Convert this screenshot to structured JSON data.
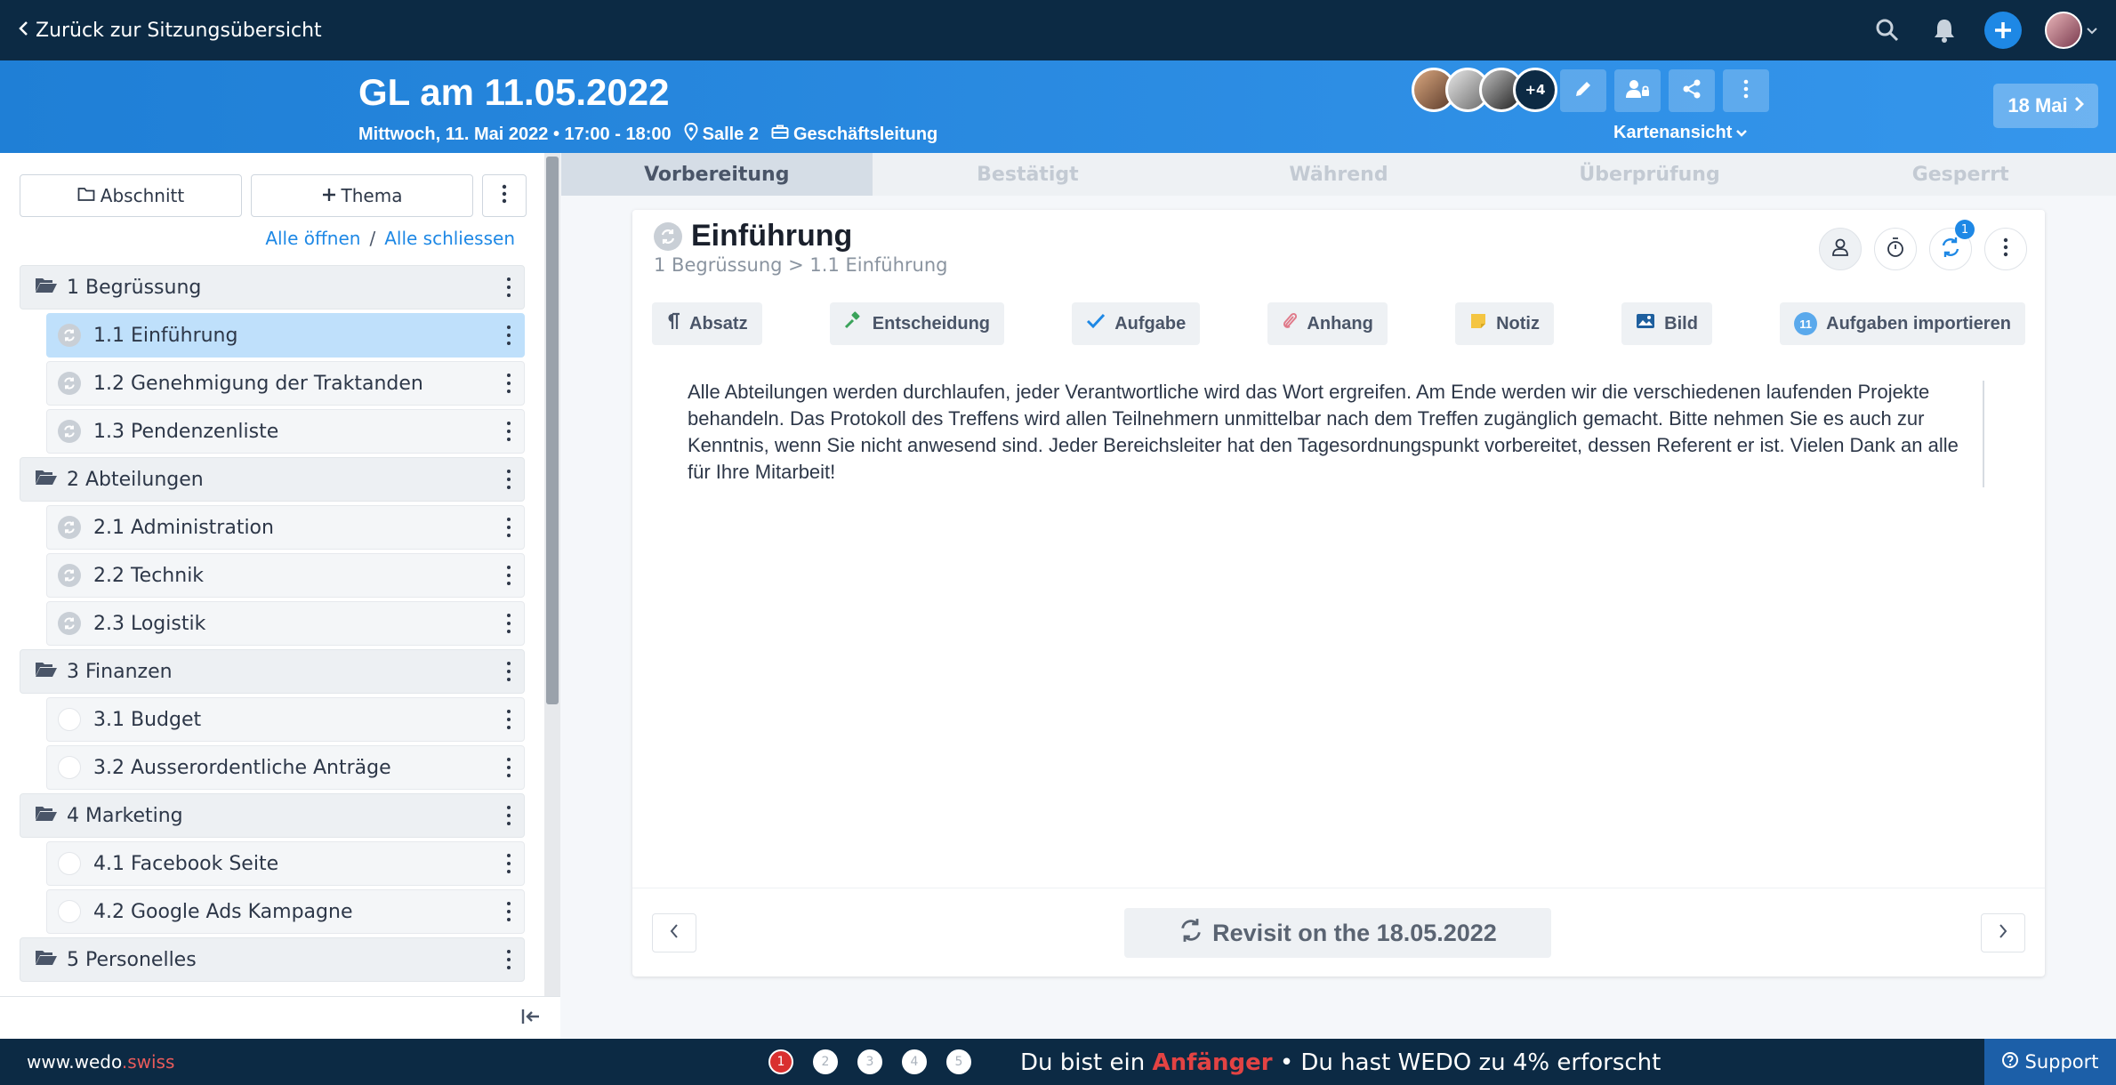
{
  "topbar": {
    "back_label": "Zurück zur Sitzungsübersicht",
    "icons": [
      "search-icon",
      "bell-icon",
      "plus-icon",
      "user-avatar"
    ]
  },
  "header": {
    "title": "GL am 11.05.2022",
    "date_time": "Mittwoch, 11. Mai 2022 • 17:00 - 18:00",
    "location": "Salle 2",
    "group": "Geschäftsleitung",
    "participants_more": "+4",
    "view_mode": "Kartenansicht",
    "next_date": "18 Mai"
  },
  "sidebar": {
    "section_button": "Abschnitt",
    "topic_button": "Thema",
    "open_all": "Alle öffnen",
    "separator": "/",
    "close_all": "Alle schliessen",
    "sections": [
      {
        "label": "1 Begrüssung",
        "items": [
          {
            "label": "1.1 Einführung",
            "status": "done",
            "active": true
          },
          {
            "label": "1.2 Genehmigung der Traktanden",
            "status": "done",
            "active": false
          },
          {
            "label": "1.3 Pendenzenliste",
            "status": "done",
            "active": false
          }
        ]
      },
      {
        "label": "2 Abteilungen",
        "items": [
          {
            "label": "2.1 Administration",
            "status": "done",
            "active": false
          },
          {
            "label": "2.2 Technik",
            "status": "done",
            "active": false
          },
          {
            "label": "2.3 Logistik",
            "status": "done",
            "active": false
          }
        ]
      },
      {
        "label": "3 Finanzen",
        "items": [
          {
            "label": "3.1 Budget",
            "status": "empty",
            "active": false
          },
          {
            "label": "3.2 Ausserordentliche Anträge",
            "status": "empty",
            "active": false
          }
        ]
      },
      {
        "label": "4 Marketing",
        "items": [
          {
            "label": "4.1 Facebook Seite",
            "status": "empty",
            "active": false
          },
          {
            "label": "4.2 Google Ads Kampagne",
            "status": "empty",
            "active": false
          }
        ]
      },
      {
        "label": "5 Personelles",
        "items": []
      }
    ]
  },
  "stepper": [
    "Vorbereitung",
    "Bestätigt",
    "Während",
    "Überprüfung",
    "Gesperrt"
  ],
  "card": {
    "title": "Einführung",
    "breadcrumb": "1 Begrüssung > 1.1 Einführung",
    "sync_badge": "1",
    "add_buttons": {
      "paragraph": "Absatz",
      "decision": "Entscheidung",
      "task": "Aufgabe",
      "attachment": "Anhang",
      "note": "Notiz",
      "image": "Bild",
      "import_count": "11",
      "import": "Aufgaben importieren"
    },
    "content": "Alle Abteilungen werden durchlaufen, jeder Verantwortliche wird das Wort ergreifen. Am Ende werden wir die verschiedenen laufenden Projekte behandeln. Das Protokoll des Treffens wird allen Teilnehmern unmittelbar nach dem Treffen zugänglich gemacht. Bitte nehmen Sie es auch zur Kenntnis, wenn Sie nicht anwesend sind. Jeder Bereichsleiter hat den Tagesordnungspunkt vorbereitet, dessen Referent er ist. Vielen Dank an alle für Ihre Mitarbeit!",
    "revisit": "Revisit on the 18.05.2022"
  },
  "bottombar": {
    "site_prefix": "www.wedo",
    "site_suffix": ".swiss",
    "dots": [
      "1",
      "2",
      "3",
      "4",
      "5"
    ],
    "level_prefix": "Du bist ein",
    "level": "Anfänger",
    "level_suffix": "• Du hast WEDO zu 4% erforscht",
    "support": "Support"
  },
  "colors": {
    "navy": "#0c2a44",
    "header_blue": "#1f7fd6",
    "accent": "#1e88e5",
    "active_item": "#bfe0fb",
    "level_red": "#e34343"
  }
}
